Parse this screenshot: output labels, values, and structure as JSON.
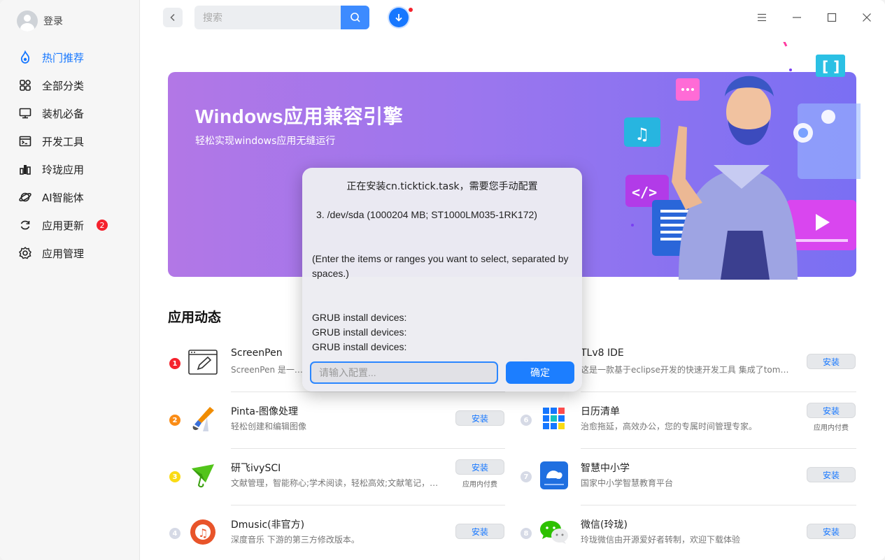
{
  "sidebar": {
    "login_label": "登录",
    "items": [
      {
        "label": "热门推荐",
        "icon": "flame-icon",
        "active": true
      },
      {
        "label": "全部分类",
        "icon": "grid-icon"
      },
      {
        "label": "装机必备",
        "icon": "monitor-icon"
      },
      {
        "label": "开发工具",
        "icon": "terminal-icon"
      },
      {
        "label": "玲珑应用",
        "icon": "bar-chart-icon"
      },
      {
        "label": "AI智能体",
        "icon": "planet-icon"
      },
      {
        "label": "应用更新",
        "icon": "refresh-icon",
        "badge": "2"
      },
      {
        "label": "应用管理",
        "icon": "gear-icon"
      }
    ]
  },
  "topbar": {
    "search_placeholder": "搜索"
  },
  "banner": {
    "title": "Windows应用兼容引擎",
    "subtitle": "轻松实现windows应用无缝运行"
  },
  "section": {
    "title": "应用动态"
  },
  "apps_left": [
    {
      "rank": "1",
      "name": "ScreenPen",
      "desc": "ScreenPen 是一个简",
      "install": "",
      "extra": ""
    },
    {
      "rank": "2",
      "name": "Pinta-图像处理",
      "desc": "轻松创建和编辑图像",
      "install": "安装",
      "extra": ""
    },
    {
      "rank": "3",
      "name": "研飞ivySCI",
      "desc": "文献管理，智能称心;学术阅读，轻松高效;文献笔记，…",
      "install": "安装",
      "extra": "应用内付费"
    },
    {
      "rank": "4",
      "name": "Dmusic(非官方)",
      "desc": "深度音乐 下游的第三方修改版本。",
      "install": "安装",
      "extra": ""
    }
  ],
  "apps_right": [
    {
      "rank": "5",
      "name": "TLv8 IDE",
      "desc": "这是一款基于eclipse开发的快速开发工具 集成了tomc…",
      "install": "安装",
      "extra": ""
    },
    {
      "rank": "6",
      "name": "日历清单",
      "desc": "治愈拖延，高效办公，您的专属时间管理专家。",
      "install": "安装",
      "extra": "应用内付费"
    },
    {
      "rank": "7",
      "name": "智慧中小学",
      "desc": "国家中小学智慧教育平台",
      "install": "安装",
      "extra": ""
    },
    {
      "rank": "8",
      "name": "微信(玲珑)",
      "desc": "玲珑微信由开源爱好者转制，欢迎下载体验",
      "install": "安装",
      "extra": ""
    }
  ],
  "dialog": {
    "title": "正在安装cn.ticktick.task，需要您手动配置",
    "device_line": "3. /dev/sda (1000204 MB; ST1000LM035-1RK172)",
    "instructions": "(Enter the items or ranges you want to select, separated by spaces.)",
    "grub_lines": [
      "GRUB install devices:",
      "GRUB install devices:",
      "GRUB install devices:"
    ],
    "input_placeholder": "请输入配置...",
    "confirm_label": "确定"
  },
  "colors": {
    "accent": "#1677ff",
    "badge": "#f5222d",
    "banner_start": "#b277e6",
    "banner_end": "#7a6ff3"
  }
}
